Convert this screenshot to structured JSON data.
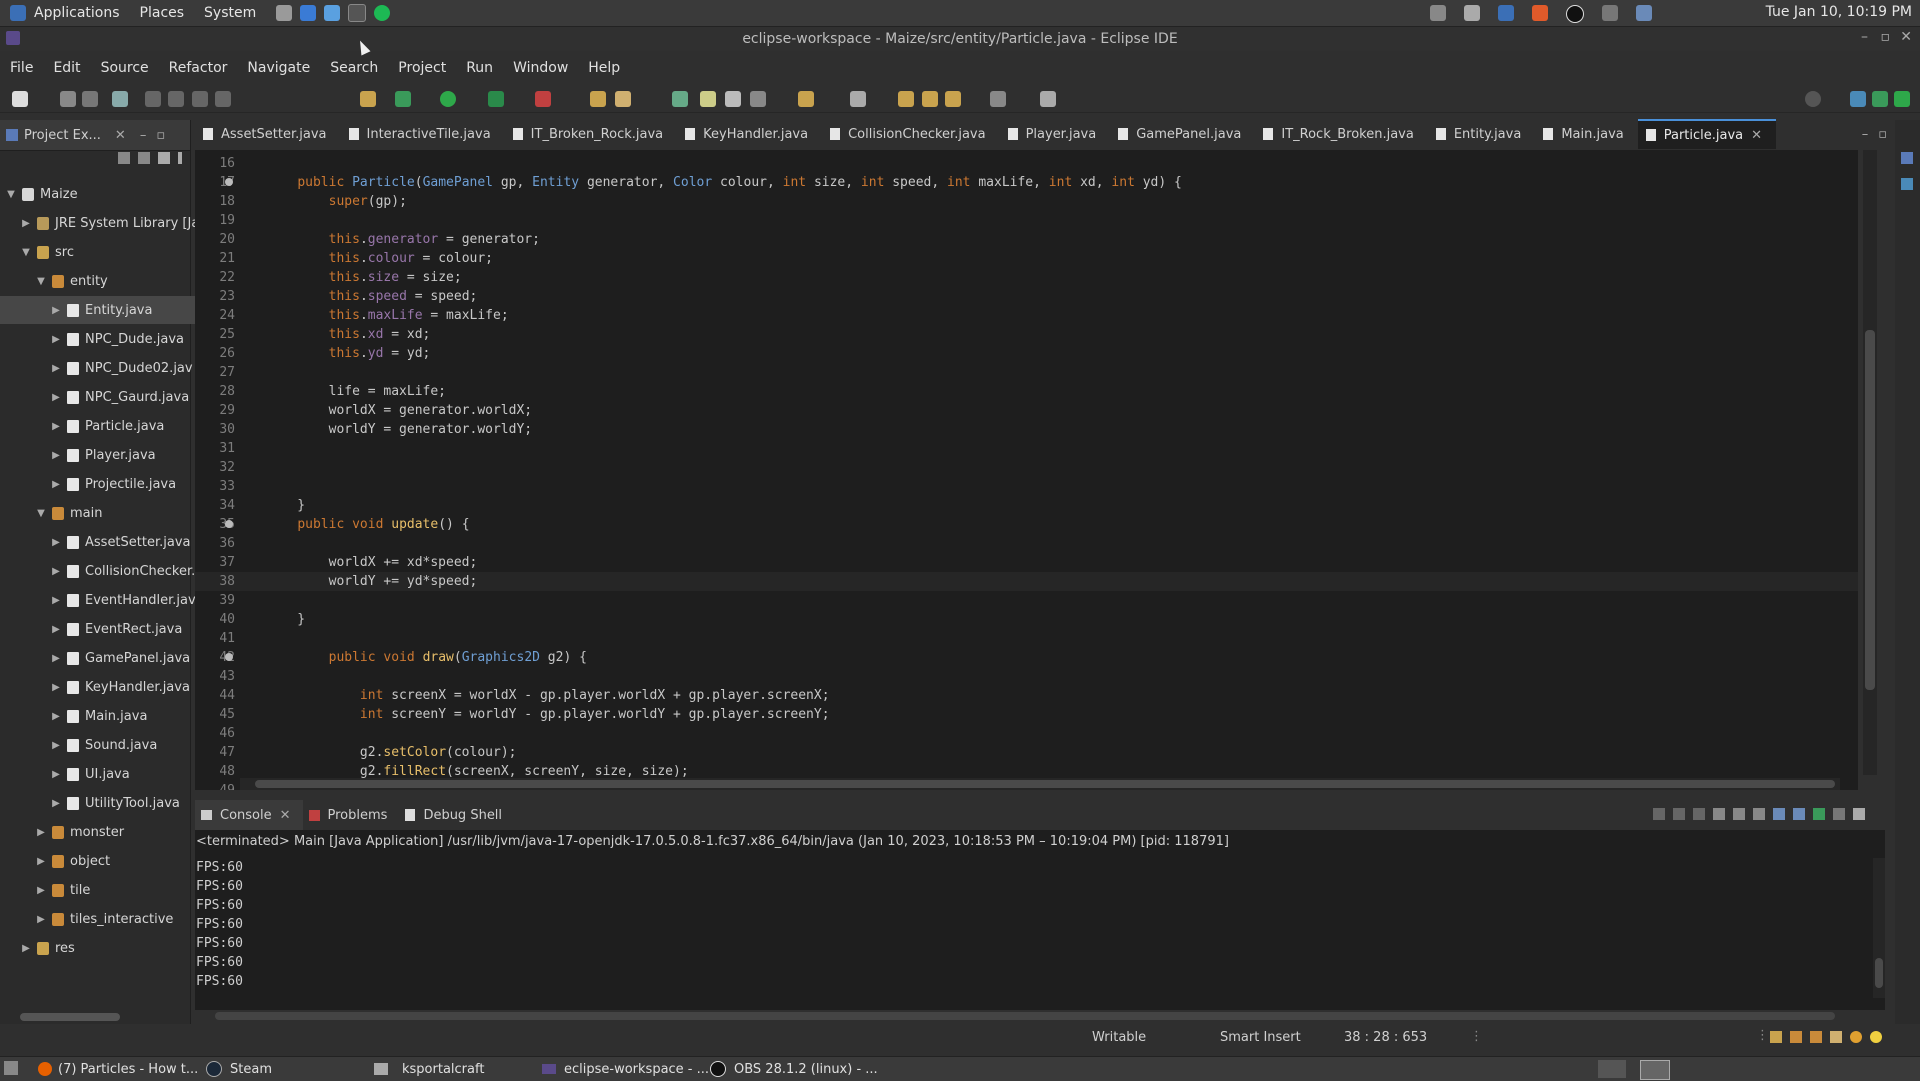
{
  "system_panel": {
    "menus": [
      "Applications",
      "Places",
      "System"
    ],
    "clock": "Tue Jan 10, 10:19 PM"
  },
  "window": {
    "title": "eclipse-workspace - Maize/src/entity/Particle.java - Eclipse IDE"
  },
  "menubar": [
    "File",
    "Edit",
    "Source",
    "Refactor",
    "Navigate",
    "Search",
    "Project",
    "Run",
    "Window",
    "Help"
  ],
  "project_explorer": {
    "tab_label": "Project Ex...",
    "tree": [
      {
        "label": "Maize",
        "depth": 0,
        "icon": "project-icon",
        "expanded": true
      },
      {
        "label": "JRE System Library [Ja",
        "depth": 1,
        "icon": "library-icon",
        "expanded": false
      },
      {
        "label": "src",
        "depth": 1,
        "icon": "source-folder-icon",
        "expanded": true
      },
      {
        "label": "entity",
        "depth": 2,
        "icon": "package-icon",
        "expanded": true
      },
      {
        "label": "Entity.java",
        "depth": 3,
        "icon": "java-file-icon",
        "expanded": false,
        "selected": true
      },
      {
        "label": "NPC_Dude.java",
        "depth": 3,
        "icon": "java-file-icon",
        "expanded": false
      },
      {
        "label": "NPC_Dude02.jav",
        "depth": 3,
        "icon": "java-file-icon",
        "expanded": false
      },
      {
        "label": "NPC_Gaurd.java",
        "depth": 3,
        "icon": "java-file-icon",
        "expanded": false
      },
      {
        "label": "Particle.java",
        "depth": 3,
        "icon": "java-file-icon",
        "expanded": false
      },
      {
        "label": "Player.java",
        "depth": 3,
        "icon": "java-file-icon",
        "expanded": false
      },
      {
        "label": "Projectile.java",
        "depth": 3,
        "icon": "java-file-icon",
        "expanded": false
      },
      {
        "label": "main",
        "depth": 2,
        "icon": "package-icon",
        "expanded": true
      },
      {
        "label": "AssetSetter.java",
        "depth": 3,
        "icon": "java-file-icon",
        "expanded": false
      },
      {
        "label": "CollisionChecker.j",
        "depth": 3,
        "icon": "java-file-icon",
        "expanded": false
      },
      {
        "label": "EventHandler.jav",
        "depth": 3,
        "icon": "java-file-icon",
        "expanded": false
      },
      {
        "label": "EventRect.java",
        "depth": 3,
        "icon": "java-file-icon",
        "expanded": false
      },
      {
        "label": "GamePanel.java",
        "depth": 3,
        "icon": "java-file-icon",
        "expanded": false
      },
      {
        "label": "KeyHandler.java",
        "depth": 3,
        "icon": "java-file-icon",
        "expanded": false
      },
      {
        "label": "Main.java",
        "depth": 3,
        "icon": "java-file-icon",
        "expanded": false
      },
      {
        "label": "Sound.java",
        "depth": 3,
        "icon": "java-file-icon",
        "expanded": false
      },
      {
        "label": "UI.java",
        "depth": 3,
        "icon": "java-file-icon",
        "expanded": false
      },
      {
        "label": "UtilityTool.java",
        "depth": 3,
        "icon": "java-file-icon",
        "expanded": false
      },
      {
        "label": "monster",
        "depth": 2,
        "icon": "package-icon",
        "expanded": false
      },
      {
        "label": "object",
        "depth": 2,
        "icon": "package-icon",
        "expanded": false
      },
      {
        "label": "tile",
        "depth": 2,
        "icon": "package-icon",
        "expanded": false
      },
      {
        "label": "tiles_interactive",
        "depth": 2,
        "icon": "package-icon",
        "expanded": false
      },
      {
        "label": "res",
        "depth": 1,
        "icon": "folder-icon",
        "expanded": false
      }
    ]
  },
  "editor_tabs": [
    "AssetSetter.java",
    "InteractiveTile.java",
    "IT_Broken_Rock.java",
    "KeyHandler.java",
    "CollisionChecker.java",
    "Player.java",
    "GamePanel.java",
    "IT_Rock_Broken.java",
    "Entity.java",
    "Main.java",
    "Particle.java"
  ],
  "active_tab": "Particle.java",
  "code_lines": [
    {
      "n": "16",
      "t": ""
    },
    {
      "n": "17",
      "t": "\tpublic Particle(GamePanel gp, Entity generator, Color colour, int size, int speed, int maxLife, int xd, int yd) {"
    },
    {
      "n": "18",
      "t": "\t\tsuper(gp);"
    },
    {
      "n": "19",
      "t": ""
    },
    {
      "n": "20",
      "t": "\t\tthis.generator = generator;"
    },
    {
      "n": "21",
      "t": "\t\tthis.colour = colour;"
    },
    {
      "n": "22",
      "t": "\t\tthis.size = size;"
    },
    {
      "n": "23",
      "t": "\t\tthis.speed = speed;"
    },
    {
      "n": "24",
      "t": "\t\tthis.maxLife = maxLife;"
    },
    {
      "n": "25",
      "t": "\t\tthis.xd = xd;"
    },
    {
      "n": "26",
      "t": "\t\tthis.yd = yd;"
    },
    {
      "n": "27",
      "t": ""
    },
    {
      "n": "28",
      "t": "\t\tlife = maxLife;"
    },
    {
      "n": "29",
      "t": "\t\tworldX = generator.worldX;"
    },
    {
      "n": "30",
      "t": "\t\tworldY = generator.worldY;"
    },
    {
      "n": "31",
      "t": ""
    },
    {
      "n": "32",
      "t": ""
    },
    {
      "n": "33",
      "t": ""
    },
    {
      "n": "34",
      "t": "\t}"
    },
    {
      "n": "35",
      "t": "\tpublic void update() {"
    },
    {
      "n": "36",
      "t": ""
    },
    {
      "n": "37",
      "t": "\t\tworldX += xd*speed;"
    },
    {
      "n": "38",
      "t": "\t\tworldY += yd*speed;"
    },
    {
      "n": "39",
      "t": ""
    },
    {
      "n": "40",
      "t": "\t}"
    },
    {
      "n": "41",
      "t": ""
    },
    {
      "n": "42",
      "t": "\t\tpublic void draw(Graphics2D g2) {"
    },
    {
      "n": "43",
      "t": ""
    },
    {
      "n": "44",
      "t": "\t\t\tint screenX = worldX - gp.player.worldX + gp.player.screenX;"
    },
    {
      "n": "45",
      "t": "\t\t\tint screenY = worldY - gp.player.worldY + gp.player.screenY;"
    },
    {
      "n": "46",
      "t": ""
    },
    {
      "n": "47",
      "t": "\t\t\tg2.setColor(colour);"
    },
    {
      "n": "48",
      "t": "\t\t\tg2.fillRect(screenX, screenY, size, size);"
    },
    {
      "n": "49",
      "t": ""
    }
  ],
  "current_line": "38",
  "console_tabs": [
    "Console",
    "Problems",
    "Debug Shell"
  ],
  "console": {
    "terminated": "<terminated> Main [Java Application] /usr/lib/jvm/java-17-openjdk-17.0.5.0.8-1.fc37.x86_64/bin/java  (Jan 10, 2023, 10:18:53 PM – 10:19:04 PM) [pid: 118791]",
    "lines": [
      "FPS:60",
      "FPS:60",
      "FPS:60",
      "FPS:60",
      "FPS:60",
      "FPS:60",
      "FPS:60"
    ]
  },
  "status": {
    "writable": "Writable",
    "insert_mode": "Smart Insert",
    "position": "38 : 28 : 653"
  },
  "taskbar": [
    {
      "label": "(7) Particles - How t...",
      "icon": "firefox-icon"
    },
    {
      "label": "Steam",
      "icon": "steam-icon"
    },
    {
      "label": "ksportalcraft",
      "icon": "folder-icon"
    },
    {
      "label": "eclipse-workspace - ...",
      "icon": "eclipse-icon"
    },
    {
      "label": "OBS 28.1.2 (linux) - ...",
      "icon": "obs-icon"
    }
  ],
  "colors": {
    "keyword": "#cc7832",
    "type": "#6f9fd4",
    "field": "#9876aa",
    "method": "#e8bf6a",
    "active_tab_accent": "#4a90d9"
  }
}
